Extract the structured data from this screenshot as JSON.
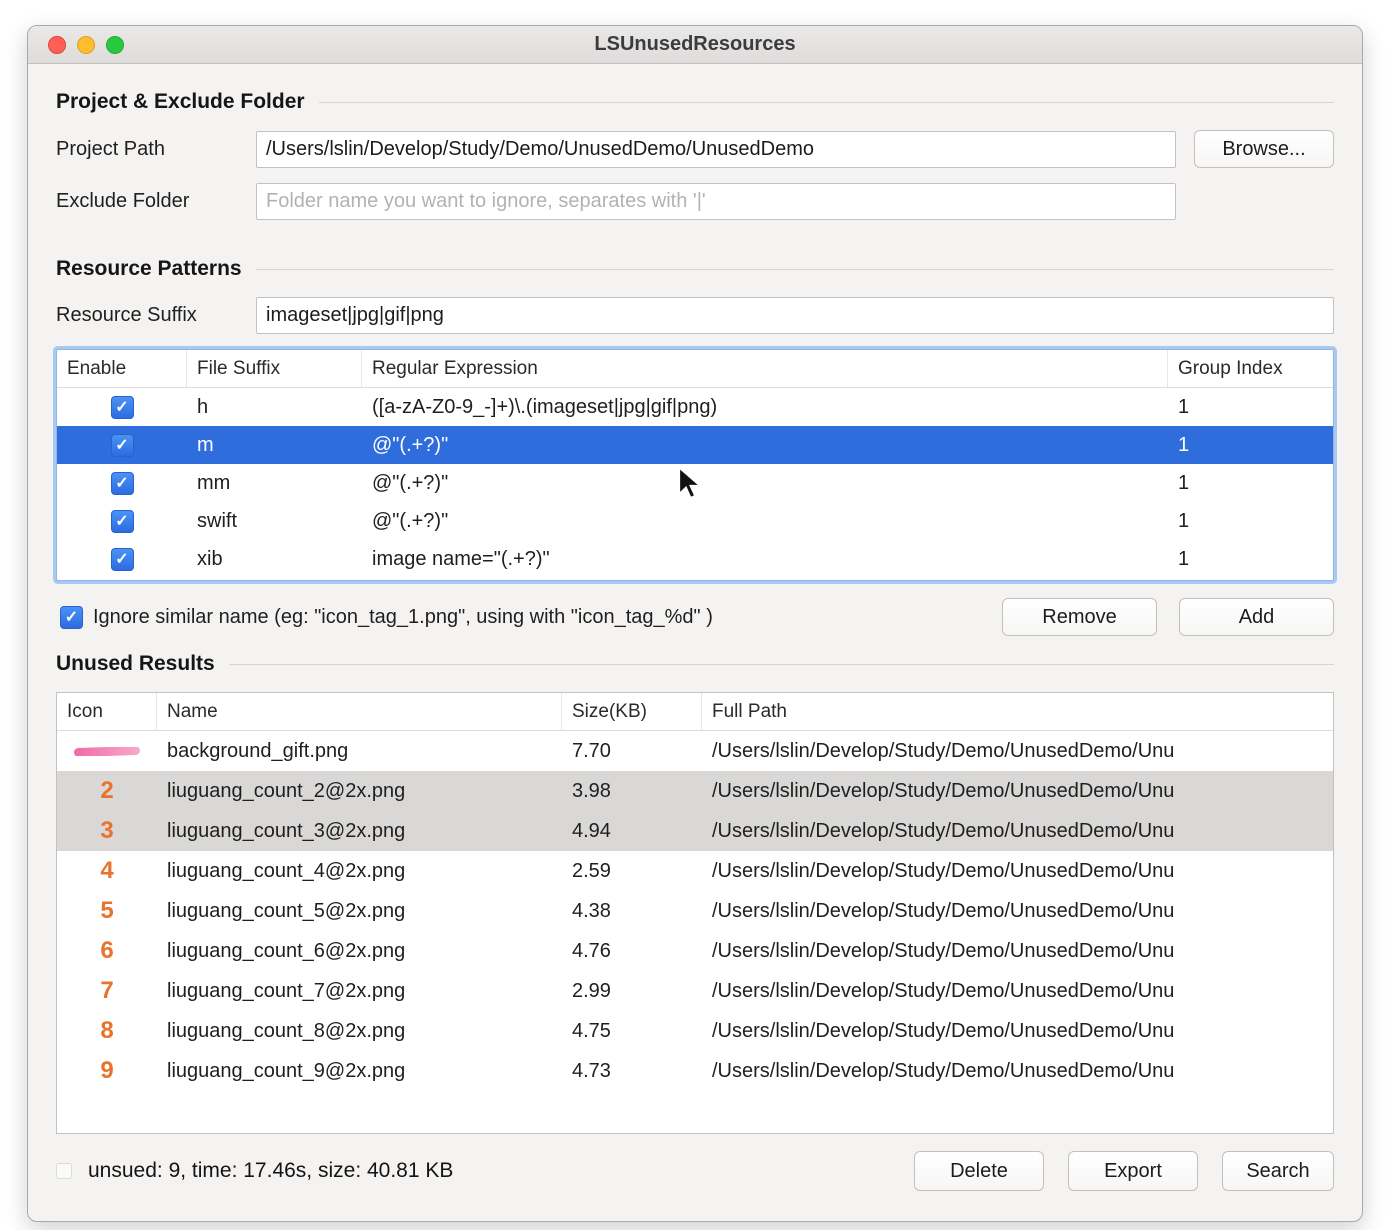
{
  "window": {
    "title": "LSUnusedResources"
  },
  "icons": {
    "check_glyph": "✓"
  },
  "project_section": {
    "heading": "Project & Exclude Folder",
    "project_path_label": "Project Path",
    "project_path_value": "/Users/lslin/Develop/Study/Demo/UnusedDemo/UnusedDemo",
    "browse_label": "Browse...",
    "exclude_label": "Exclude Folder",
    "exclude_placeholder": "Folder name you want to ignore, separates with '|'"
  },
  "patterns_section": {
    "heading": "Resource Patterns",
    "suffix_label": "Resource Suffix",
    "suffix_value": "imageset|jpg|gif|png",
    "table": {
      "columns": [
        "Enable",
        "File Suffix",
        "Regular Expression",
        "Group Index"
      ],
      "rows": [
        {
          "enabled": true,
          "suffix": "h",
          "regex": "([a-zA-Z0-9_-]+)\\.(imageset|jpg|gif|png)",
          "group": "1",
          "selected": false
        },
        {
          "enabled": true,
          "suffix": "m",
          "regex": "@\"(.+?)\"",
          "group": "1",
          "selected": true
        },
        {
          "enabled": true,
          "suffix": "mm",
          "regex": "@\"(.+?)\"",
          "group": "1",
          "selected": false
        },
        {
          "enabled": true,
          "suffix": "swift",
          "regex": "@\"(.+?)\"",
          "group": "1",
          "selected": false
        },
        {
          "enabled": true,
          "suffix": "xib",
          "regex": "image name=\"(.+?)\"",
          "group": "1",
          "selected": false
        }
      ]
    },
    "ignore_checkbox_label": "Ignore similar name (eg: \"icon_tag_1.png\", using with \"icon_tag_%d\" )",
    "ignore_checked": true,
    "remove_label": "Remove",
    "add_label": "Add"
  },
  "results_section": {
    "heading": "Unused Results",
    "table": {
      "columns": [
        "Icon",
        "Name",
        "Size(KB)",
        "Full Path"
      ],
      "rows": [
        {
          "icon_kind": "pink-scribble",
          "icon_label": "",
          "name": "background_gift.png",
          "size": "7.70",
          "path": "/Users/lslin/Develop/Study/Demo/UnusedDemo/Unu",
          "highlight": false
        },
        {
          "icon_kind": "number",
          "icon_label": "2",
          "name": "liuguang_count_2@2x.png",
          "size": "3.98",
          "path": "/Users/lslin/Develop/Study/Demo/UnusedDemo/Unu",
          "highlight": true
        },
        {
          "icon_kind": "number",
          "icon_label": "3",
          "name": "liuguang_count_3@2x.png",
          "size": "4.94",
          "path": "/Users/lslin/Develop/Study/Demo/UnusedDemo/Unu",
          "highlight": true
        },
        {
          "icon_kind": "number",
          "icon_label": "4",
          "name": "liuguang_count_4@2x.png",
          "size": "2.59",
          "path": "/Users/lslin/Develop/Study/Demo/UnusedDemo/Unu",
          "highlight": false
        },
        {
          "icon_kind": "number",
          "icon_label": "5",
          "name": "liuguang_count_5@2x.png",
          "size": "4.38",
          "path": "/Users/lslin/Develop/Study/Demo/UnusedDemo/Unu",
          "highlight": false
        },
        {
          "icon_kind": "number",
          "icon_label": "6",
          "name": "liuguang_count_6@2x.png",
          "size": "4.76",
          "path": "/Users/lslin/Develop/Study/Demo/UnusedDemo/Unu",
          "highlight": false
        },
        {
          "icon_kind": "number",
          "icon_label": "7",
          "name": "liuguang_count_7@2x.png",
          "size": "2.99",
          "path": "/Users/lslin/Develop/Study/Demo/UnusedDemo/Unu",
          "highlight": false
        },
        {
          "icon_kind": "number",
          "icon_label": "8",
          "name": "liuguang_count_8@2x.png",
          "size": "4.75",
          "path": "/Users/lslin/Develop/Study/Demo/UnusedDemo/Unu",
          "highlight": false
        },
        {
          "icon_kind": "number",
          "icon_label": "9",
          "name": "liuguang_count_9@2x.png",
          "size": "4.73",
          "path": "/Users/lslin/Develop/Study/Demo/UnusedDemo/Unu",
          "highlight": false
        }
      ]
    }
  },
  "status_bar": {
    "status_text": "unsued: 9, time: 17.46s, size: 40.81 KB",
    "delete_label": "Delete",
    "export_label": "Export",
    "search_label": "Search"
  }
}
